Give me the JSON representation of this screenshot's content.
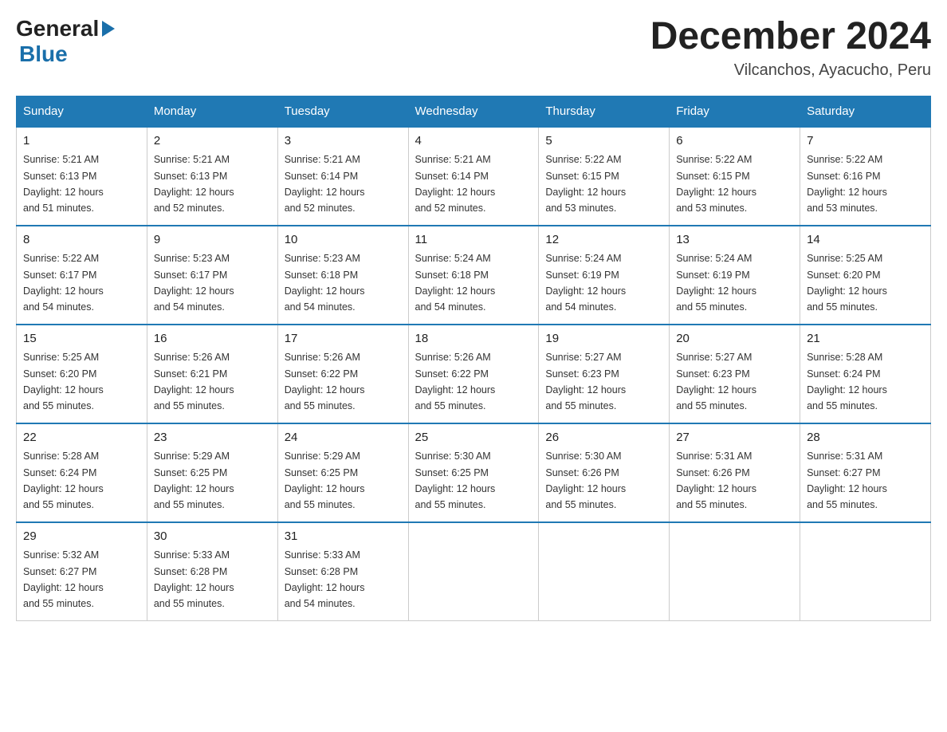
{
  "header": {
    "logo": {
      "text_general": "General",
      "text_blue": "Blue",
      "arrow": "▶"
    },
    "title": "December 2024",
    "location": "Vilcanchos, Ayacucho, Peru"
  },
  "calendar": {
    "days_of_week": [
      "Sunday",
      "Monday",
      "Tuesday",
      "Wednesday",
      "Thursday",
      "Friday",
      "Saturday"
    ],
    "weeks": [
      [
        {
          "day": "1",
          "sunrise": "5:21 AM",
          "sunset": "6:13 PM",
          "daylight": "12 hours and 51 minutes."
        },
        {
          "day": "2",
          "sunrise": "5:21 AM",
          "sunset": "6:13 PM",
          "daylight": "12 hours and 52 minutes."
        },
        {
          "day": "3",
          "sunrise": "5:21 AM",
          "sunset": "6:14 PM",
          "daylight": "12 hours and 52 minutes."
        },
        {
          "day": "4",
          "sunrise": "5:21 AM",
          "sunset": "6:14 PM",
          "daylight": "12 hours and 52 minutes."
        },
        {
          "day": "5",
          "sunrise": "5:22 AM",
          "sunset": "6:15 PM",
          "daylight": "12 hours and 53 minutes."
        },
        {
          "day": "6",
          "sunrise": "5:22 AM",
          "sunset": "6:15 PM",
          "daylight": "12 hours and 53 minutes."
        },
        {
          "day": "7",
          "sunrise": "5:22 AM",
          "sunset": "6:16 PM",
          "daylight": "12 hours and 53 minutes."
        }
      ],
      [
        {
          "day": "8",
          "sunrise": "5:22 AM",
          "sunset": "6:17 PM",
          "daylight": "12 hours and 54 minutes."
        },
        {
          "day": "9",
          "sunrise": "5:23 AM",
          "sunset": "6:17 PM",
          "daylight": "12 hours and 54 minutes."
        },
        {
          "day": "10",
          "sunrise": "5:23 AM",
          "sunset": "6:18 PM",
          "daylight": "12 hours and 54 minutes."
        },
        {
          "day": "11",
          "sunrise": "5:24 AM",
          "sunset": "6:18 PM",
          "daylight": "12 hours and 54 minutes."
        },
        {
          "day": "12",
          "sunrise": "5:24 AM",
          "sunset": "6:19 PM",
          "daylight": "12 hours and 54 minutes."
        },
        {
          "day": "13",
          "sunrise": "5:24 AM",
          "sunset": "6:19 PM",
          "daylight": "12 hours and 55 minutes."
        },
        {
          "day": "14",
          "sunrise": "5:25 AM",
          "sunset": "6:20 PM",
          "daylight": "12 hours and 55 minutes."
        }
      ],
      [
        {
          "day": "15",
          "sunrise": "5:25 AM",
          "sunset": "6:20 PM",
          "daylight": "12 hours and 55 minutes."
        },
        {
          "day": "16",
          "sunrise": "5:26 AM",
          "sunset": "6:21 PM",
          "daylight": "12 hours and 55 minutes."
        },
        {
          "day": "17",
          "sunrise": "5:26 AM",
          "sunset": "6:22 PM",
          "daylight": "12 hours and 55 minutes."
        },
        {
          "day": "18",
          "sunrise": "5:26 AM",
          "sunset": "6:22 PM",
          "daylight": "12 hours and 55 minutes."
        },
        {
          "day": "19",
          "sunrise": "5:27 AM",
          "sunset": "6:23 PM",
          "daylight": "12 hours and 55 minutes."
        },
        {
          "day": "20",
          "sunrise": "5:27 AM",
          "sunset": "6:23 PM",
          "daylight": "12 hours and 55 minutes."
        },
        {
          "day": "21",
          "sunrise": "5:28 AM",
          "sunset": "6:24 PM",
          "daylight": "12 hours and 55 minutes."
        }
      ],
      [
        {
          "day": "22",
          "sunrise": "5:28 AM",
          "sunset": "6:24 PM",
          "daylight": "12 hours and 55 minutes."
        },
        {
          "day": "23",
          "sunrise": "5:29 AM",
          "sunset": "6:25 PM",
          "daylight": "12 hours and 55 minutes."
        },
        {
          "day": "24",
          "sunrise": "5:29 AM",
          "sunset": "6:25 PM",
          "daylight": "12 hours and 55 minutes."
        },
        {
          "day": "25",
          "sunrise": "5:30 AM",
          "sunset": "6:25 PM",
          "daylight": "12 hours and 55 minutes."
        },
        {
          "day": "26",
          "sunrise": "5:30 AM",
          "sunset": "6:26 PM",
          "daylight": "12 hours and 55 minutes."
        },
        {
          "day": "27",
          "sunrise": "5:31 AM",
          "sunset": "6:26 PM",
          "daylight": "12 hours and 55 minutes."
        },
        {
          "day": "28",
          "sunrise": "5:31 AM",
          "sunset": "6:27 PM",
          "daylight": "12 hours and 55 minutes."
        }
      ],
      [
        {
          "day": "29",
          "sunrise": "5:32 AM",
          "sunset": "6:27 PM",
          "daylight": "12 hours and 55 minutes."
        },
        {
          "day": "30",
          "sunrise": "5:33 AM",
          "sunset": "6:28 PM",
          "daylight": "12 hours and 55 minutes."
        },
        {
          "day": "31",
          "sunrise": "5:33 AM",
          "sunset": "6:28 PM",
          "daylight": "12 hours and 54 minutes."
        },
        null,
        null,
        null,
        null
      ]
    ],
    "labels": {
      "sunrise": "Sunrise:",
      "sunset": "Sunset:",
      "daylight": "Daylight:"
    }
  }
}
